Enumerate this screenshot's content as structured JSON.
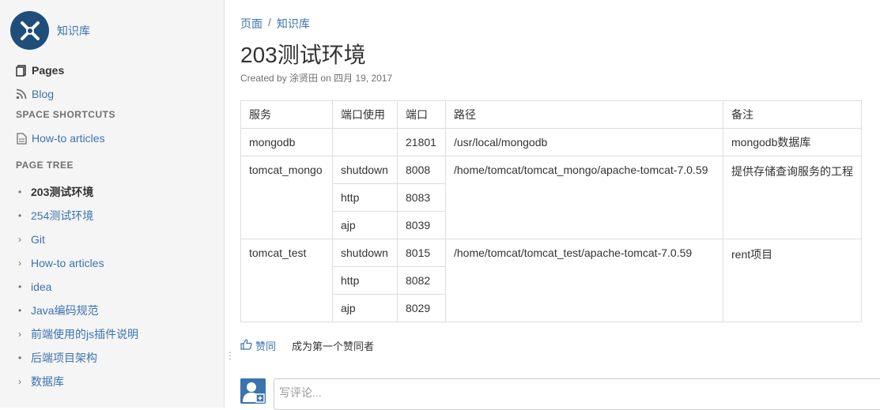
{
  "space": {
    "name": "知识库"
  },
  "nav": {
    "pages": "Pages",
    "blog": "Blog",
    "shortcuts_title": "SPACE SHORTCUTS",
    "shortcut_howto": "How-to articles",
    "tree_title": "PAGE TREE"
  },
  "tree": [
    {
      "label": "203测试环境",
      "marker": "dot",
      "current": true
    },
    {
      "label": "254测试环境",
      "marker": "dot"
    },
    {
      "label": "Git",
      "marker": "chevron"
    },
    {
      "label": "How-to articles",
      "marker": "chevron"
    },
    {
      "label": "idea",
      "marker": "dot"
    },
    {
      "label": "Java编码规范",
      "marker": "dot"
    },
    {
      "label": "前端使用的js插件说明",
      "marker": "chevron"
    },
    {
      "label": "后端项目架构",
      "marker": "dot"
    },
    {
      "label": "数据库",
      "marker": "chevron"
    }
  ],
  "breadcrumb": {
    "first": "页面",
    "sep": "/",
    "second": "知识库"
  },
  "page": {
    "title": "203测试环境",
    "created_by": "Created by",
    "author": "涂贤田",
    "on": "on",
    "date": "四月 19, 2017"
  },
  "table": {
    "headers": [
      "服务",
      "端口使用",
      "端口",
      "路径",
      "备注"
    ],
    "groups": [
      {
        "service": "mongodb",
        "path": "/usr/local/mongodb",
        "note": "mongodb数据库",
        "rows": [
          {
            "use": "",
            "port": "21801"
          }
        ]
      },
      {
        "service": "tomcat_mongo",
        "path": "/home/tomcat/tomcat_mongo/apache-tomcat-7.0.59",
        "note": "提供存储查询服务的工程",
        "rows": [
          {
            "use": "shutdown",
            "port": "8008"
          },
          {
            "use": "http",
            "port": "8083"
          },
          {
            "use": "ajp",
            "port": "8039"
          }
        ]
      },
      {
        "service": "tomcat_test",
        "path": "/home/tomcat/tomcat_test/apache-tomcat-7.0.59",
        "note": "rent项目",
        "rows": [
          {
            "use": "shutdown",
            "port": "8015"
          },
          {
            "use": "http",
            "port": "8082"
          },
          {
            "use": "ajp",
            "port": "8029"
          }
        ]
      }
    ]
  },
  "likes": {
    "button": "赞同",
    "desc": "成为第一个赞同者"
  },
  "comment": {
    "placeholder": "写评论..."
  },
  "icons": {
    "pages": "pages-icon",
    "blog": "rss-icon",
    "shortcut": "page-icon",
    "like": "thumbs-up-icon",
    "avatar": "default-avatar-icon"
  },
  "colors": {
    "link": "#3b73af",
    "sidebar_bg": "#f5f5f5",
    "logo_bg": "#1f4e7a"
  }
}
